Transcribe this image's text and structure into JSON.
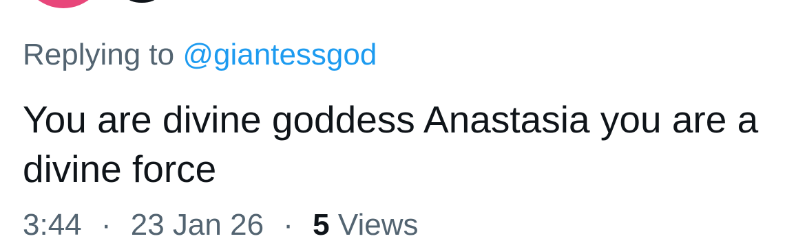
{
  "tweet": {
    "reply": {
      "prefix": "Replying to",
      "handle": "@giantessgod"
    },
    "text": "You are divine goddess Anastasia you are a divine force",
    "meta": {
      "time": "3:44",
      "date": "23 Jan 26",
      "separator": "·",
      "views_count": "5",
      "views_label": "Views"
    }
  },
  "colors": {
    "avatar": "#e8467a",
    "secondary_text": "#536471",
    "link": "#1d9bf0",
    "primary_text": "#0f1419"
  }
}
